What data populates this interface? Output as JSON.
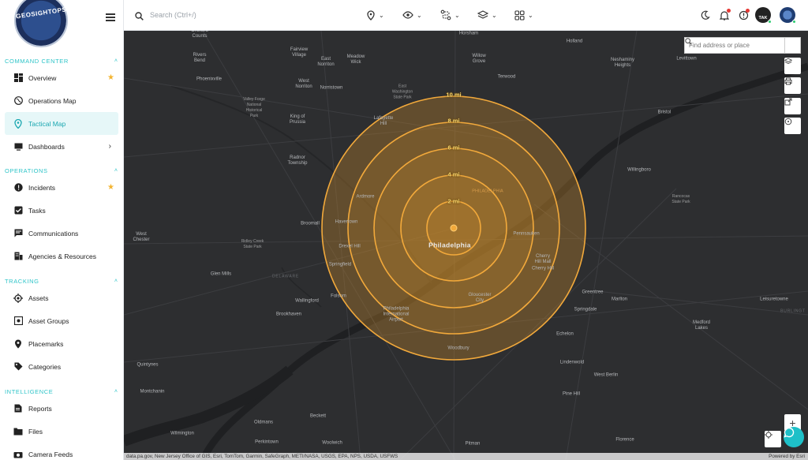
{
  "app": {
    "logo_text": "GEOSIGHTOPS"
  },
  "sidebar": {
    "sections": [
      {
        "title": "COMMAND CENTER",
        "items": [
          {
            "label": "Overview",
            "icon": "dashboard-icon",
            "starred": true
          },
          {
            "label": "Operations Map",
            "icon": "globe-icon"
          },
          {
            "label": "Tactical Map",
            "icon": "location-pin-icon",
            "active": true
          },
          {
            "label": "Dashboards",
            "icon": "monitor-icon",
            "submenu": true
          }
        ]
      },
      {
        "title": "OPERATIONS",
        "items": [
          {
            "label": "Incidents",
            "icon": "alert-circle-icon",
            "starred": true
          },
          {
            "label": "Tasks",
            "icon": "checkbox-icon"
          },
          {
            "label": "Communications",
            "icon": "chat-icon"
          },
          {
            "label": "Agencies & Resources",
            "icon": "building-icon"
          }
        ]
      },
      {
        "title": "TRACKING",
        "items": [
          {
            "label": "Assets",
            "icon": "crosshair-icon"
          },
          {
            "label": "Asset Groups",
            "icon": "group-icon"
          },
          {
            "label": "Placemarks",
            "icon": "placemark-icon"
          },
          {
            "label": "Categories",
            "icon": "tag-icon"
          }
        ]
      },
      {
        "title": "INTELLIGENCE",
        "items": [
          {
            "label": "Reports",
            "icon": "report-icon"
          },
          {
            "label": "Files",
            "icon": "folder-icon"
          },
          {
            "label": "Camera Feeds",
            "icon": "camera-icon"
          }
        ]
      }
    ]
  },
  "topbar": {
    "search_placeholder": "Search (Ctrl+/)",
    "tools": [
      "location-tool-icon",
      "eye-tool-icon",
      "route-tool-icon",
      "layers-tool-icon",
      "grid-tool-icon"
    ],
    "right_icons": [
      "dark-mode-icon",
      "notification-bell-icon",
      "alert-timer-icon",
      "tak-badge",
      "user-avatar"
    ],
    "tak_label": "TAK"
  },
  "map": {
    "address_placeholder": "Find address or place",
    "center_label": "Philadelphia",
    "ring_labels": [
      "2 mi",
      "4 mi",
      "6 mi",
      "8 mi",
      "10 mi"
    ],
    "places": [
      {
        "name": "Horsham"
      },
      {
        "name": "Holland"
      },
      {
        "name": "Neshaminy\nHeights"
      },
      {
        "name": "Levittown"
      },
      {
        "name": "Orchard\nCounts"
      },
      {
        "name": "Rivers\nBend"
      },
      {
        "name": "Phoenixville"
      },
      {
        "name": "Fairview\nVillage"
      },
      {
        "name": "East\nNorriton"
      },
      {
        "name": "Meadow\nWick"
      },
      {
        "name": "Willow\nGrove"
      },
      {
        "name": "Terwood"
      },
      {
        "name": "West\nNorriton"
      },
      {
        "name": "Norristown"
      },
      {
        "name": "East\nWashington\nState Park",
        "park": true
      },
      {
        "name": "Valley Forge\nNational\nHistorical\nPark",
        "park": true
      },
      {
        "name": "King of\nPrussia"
      },
      {
        "name": "Lafayette\nHill"
      },
      {
        "name": "Bristol"
      },
      {
        "name": "Radnor\nTownship"
      },
      {
        "name": "Willingboro"
      },
      {
        "name": "Rancocas\nState Park",
        "park": true
      },
      {
        "name": "Ardmore"
      },
      {
        "name": "Broomall"
      },
      {
        "name": "Havertown"
      },
      {
        "name": "West\nChester"
      },
      {
        "name": "Ridley Creek\nState Park",
        "park": true
      },
      {
        "name": "Drexel Hill"
      },
      {
        "name": "Pennsauken"
      },
      {
        "name": "Springfield"
      },
      {
        "name": "Cherry\nHill Mall"
      },
      {
        "name": "Cherry Hill"
      },
      {
        "name": "Glen Mills"
      },
      {
        "name": "DELAWARE",
        "water": true
      },
      {
        "name": "Greentree"
      },
      {
        "name": "Marlton"
      },
      {
        "name": "Folsom"
      },
      {
        "name": "Gloucester\nCity"
      },
      {
        "name": "Wallingford"
      },
      {
        "name": "Springdale"
      },
      {
        "name": "Leisuretowne"
      },
      {
        "name": "BURLINGT",
        "water": true
      },
      {
        "name": "Brookhaven"
      },
      {
        "name": "Philadelphia\nInternational\nAirport"
      },
      {
        "name": "Medford\nLakes"
      },
      {
        "name": "Echelon"
      },
      {
        "name": "Woodbury"
      },
      {
        "name": "Lindenwold"
      },
      {
        "name": "West Berlin"
      },
      {
        "name": "Quintynes"
      },
      {
        "name": "Montchanin"
      },
      {
        "name": "Pine Hill"
      },
      {
        "name": "Beckett"
      },
      {
        "name": "Oldmans"
      },
      {
        "name": "Wilmington"
      },
      {
        "name": "Perkintown"
      },
      {
        "name": "Woolwich"
      },
      {
        "name": "Pitman"
      },
      {
        "name": "Florence"
      },
      {
        "name": "PHILADELPHIA"
      }
    ],
    "attribution": "data.pa.gov, New Jersey Office of GIS, Esri, TomTom, Garmin, SafeGraph, METI/NASA, USGS, EPA, NPS, USDA, USFWS",
    "powered_by": "Powered by Esri",
    "ring_color": "#f2a93b",
    "fill_color": "#c98a2c"
  }
}
